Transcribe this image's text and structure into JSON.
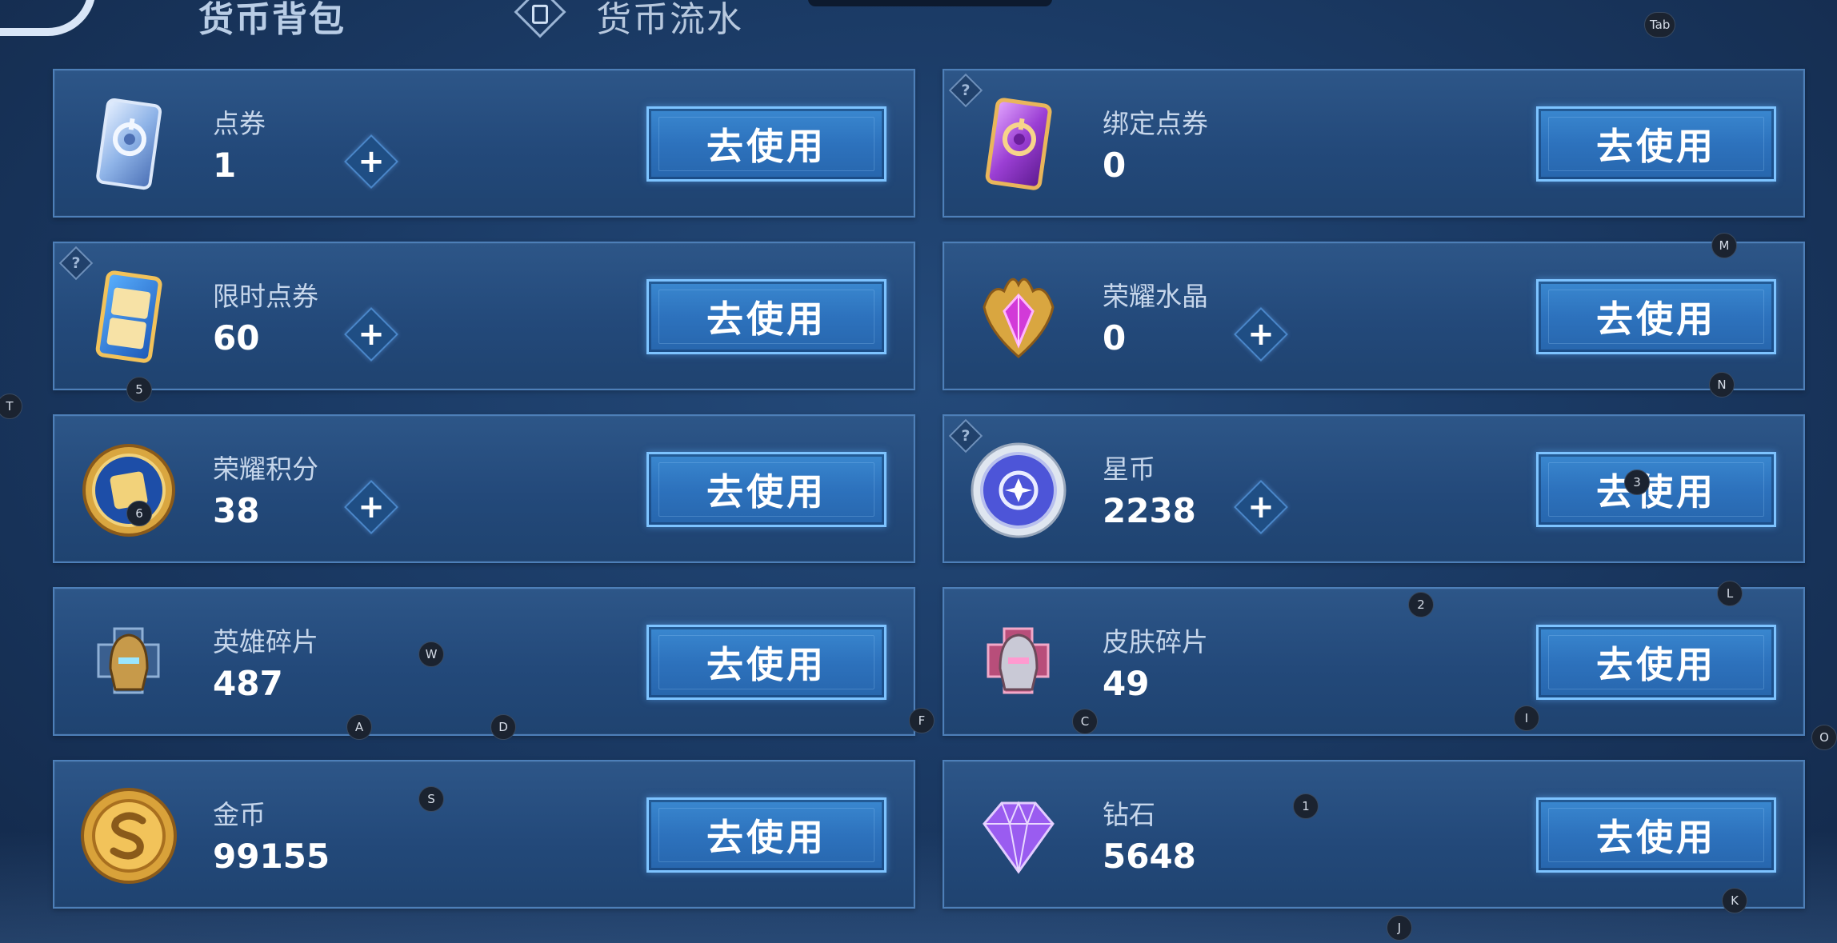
{
  "header": {
    "active_tab": "货币背包",
    "second_tab": "货币流水"
  },
  "cards": [
    {
      "id": "dianquan",
      "name": "点券",
      "value": "1",
      "has_plus": true,
      "has_help": false,
      "icon": "coupon-blue-icon",
      "button": "去使用"
    },
    {
      "id": "bangding",
      "name": "绑定点券",
      "value": "0",
      "has_plus": false,
      "has_help": true,
      "icon": "coupon-purple-icon",
      "button": "去使用"
    },
    {
      "id": "xianshi",
      "name": "限时点券",
      "value": "60",
      "has_plus": true,
      "has_help": true,
      "icon": "limited-coupon-icon",
      "button": "去使用"
    },
    {
      "id": "shuijing",
      "name": "荣耀水晶",
      "value": "0",
      "has_plus": true,
      "has_help": false,
      "icon": "glory-crystal-icon",
      "button": "去使用"
    },
    {
      "id": "jifen",
      "name": "荣耀积分",
      "value": "38",
      "has_plus": true,
      "has_help": false,
      "icon": "glory-points-icon",
      "button": "去使用"
    },
    {
      "id": "xingbi",
      "name": "星币",
      "value": "2238",
      "has_plus": true,
      "has_help": true,
      "icon": "star-coin-icon",
      "button": "去使用"
    },
    {
      "id": "yingxiong",
      "name": "英雄碎片",
      "value": "487",
      "has_plus": false,
      "has_help": false,
      "icon": "hero-fragment-icon",
      "button": "去使用"
    },
    {
      "id": "pifu",
      "name": "皮肤碎片",
      "value": "49",
      "has_plus": false,
      "has_help": false,
      "icon": "skin-fragment-icon",
      "button": "去使用"
    },
    {
      "id": "jinbi",
      "name": "金币",
      "value": "99155",
      "has_plus": false,
      "has_help": false,
      "icon": "gold-coin-icon",
      "button": "去使用"
    },
    {
      "id": "zuanshi",
      "name": "钻石",
      "value": "5648",
      "has_plus": false,
      "has_help": false,
      "icon": "diamond-icon",
      "button": "去使用"
    }
  ],
  "help_glyph": "?",
  "plus_glyph": "+",
  "hotkeys": [
    "Tab",
    "M",
    "N",
    "T",
    "5",
    "6",
    "3",
    "2",
    "L",
    "W",
    "A",
    "D",
    "F",
    "C",
    "I",
    "O",
    "S",
    "1",
    "K",
    "J"
  ]
}
